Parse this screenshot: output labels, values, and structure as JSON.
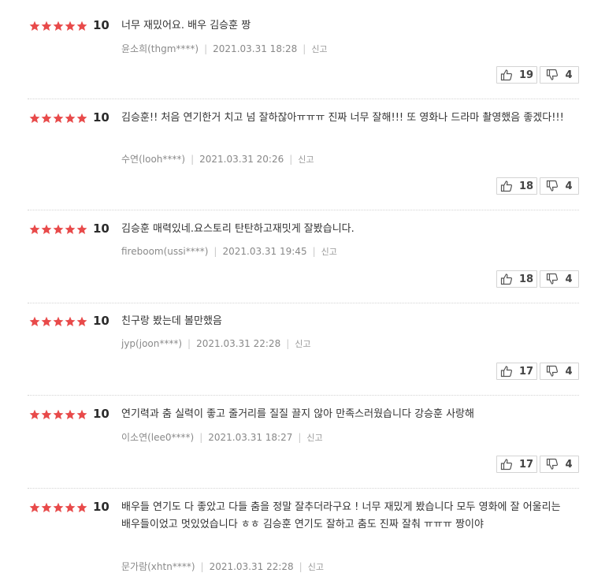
{
  "reviews": [
    {
      "score": "10",
      "text": "너무 재밌어요. 배우 김승훈 짱",
      "author": "윤소희(thgm****)",
      "date": "2021.03.31 18:28",
      "report": "신고",
      "likes": "19",
      "dislikes": "4"
    },
    {
      "score": "10",
      "text": "김승훈!! 처음 연기한거 치고 넘 잘하잖아ㅠㅠㅠ 진짜 너무 잘해!!! 또 영화나 드라마 촬영했음 좋겠다!!!",
      "author": "수연(looh****)",
      "date": "2021.03.31 20:26",
      "report": "신고",
      "likes": "18",
      "dislikes": "4"
    },
    {
      "score": "10",
      "text": "김승훈 매력있네.요스토리 탄탄하고재밋게 잘봤습니다.",
      "author": "fireboom(ussi****)",
      "date": "2021.03.31 19:45",
      "report": "신고",
      "likes": "18",
      "dislikes": "4"
    },
    {
      "score": "10",
      "text": "친구랑 봤는데 볼만했음",
      "author": "jyp(joon****)",
      "date": "2021.03.31 22:28",
      "report": "신고",
      "likes": "17",
      "dislikes": "4"
    },
    {
      "score": "10",
      "text": "연기력과 춤 실력이 좋고 줄거리를 질질 끌지 않아 만족스러웠습니다 강승훈 사랑해",
      "author": "이소연(lee0****)",
      "date": "2021.03.31 18:27",
      "report": "신고",
      "likes": "17",
      "dislikes": "4"
    },
    {
      "score": "10",
      "text": "배우들 연기도 다 좋았고 다들 춤을 정말 잘추더라구요 ! 너무 재밌게 봤습니다 모두 영화에 잘 어울리는 배우들이었고 멋있었습니다 ㅎㅎ 김승훈 연기도 잘하고 춤도 진짜 잘춰 ㅠㅠㅠ 짱이야",
      "author": "문가람(xhtn****)",
      "date": "2021.03.31 22:28",
      "report": "신고",
      "likes": "",
      "dislikes": ""
    }
  ]
}
